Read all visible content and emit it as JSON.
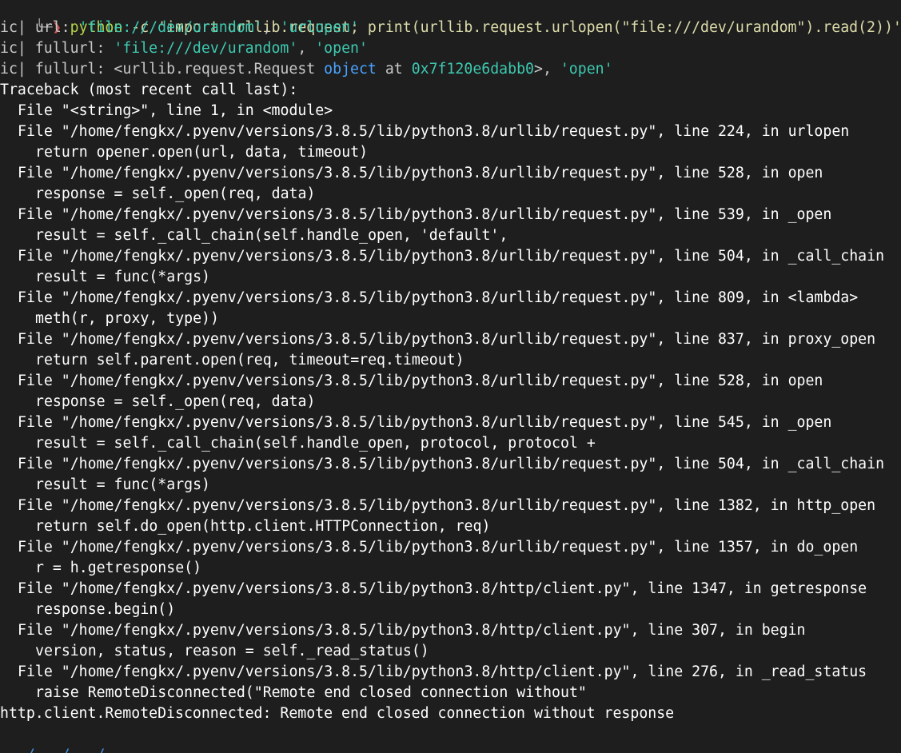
{
  "prompt": {
    "corner_glyph": "╰─",
    "arrow_glyph": "❯",
    "program": "python",
    "args": " -c 'import urllib.request; print(urllib.request.urlopen(\"file:///dev/urandom\").read(2))'"
  },
  "ic_lines": [
    {
      "prefix": "ic|",
      "key": "url",
      "value1": "'file:///dev/urandom'",
      "value2": "'urlopen'"
    },
    {
      "prefix": "ic|",
      "key": "fullurl",
      "value1": "'file:///dev/urandom'",
      "value2": "'open'"
    },
    {
      "prefix": "ic|",
      "key": "fullurl",
      "obj_pre": "<urllib.request.Request ",
      "obj_kw": "object",
      "obj_mid": " at ",
      "obj_addr": "0x7f120e6dabb0",
      "obj_post": ">",
      "value2": "'open'"
    }
  ],
  "traceback": {
    "header": "Traceback (most recent call last):",
    "frames": [
      {
        "file": "File \"<string>\", line 1, in <module>",
        "code": ""
      },
      {
        "file": "File \"/home/fengkx/.pyenv/versions/3.8.5/lib/python3.8/urllib/request.py\", line 224, in urlopen",
        "code": "return opener.open(url, data, timeout)"
      },
      {
        "file": "File \"/home/fengkx/.pyenv/versions/3.8.5/lib/python3.8/urllib/request.py\", line 528, in open",
        "code": "response = self._open(req, data)"
      },
      {
        "file": "File \"/home/fengkx/.pyenv/versions/3.8.5/lib/python3.8/urllib/request.py\", line 539, in _open",
        "code": "result = self._call_chain(self.handle_open, 'default',"
      },
      {
        "file": "File \"/home/fengkx/.pyenv/versions/3.8.5/lib/python3.8/urllib/request.py\", line 504, in _call_chain",
        "code": "result = func(*args)"
      },
      {
        "file": "File \"/home/fengkx/.pyenv/versions/3.8.5/lib/python3.8/urllib/request.py\", line 809, in <lambda>",
        "code": "meth(r, proxy, type))"
      },
      {
        "file": "File \"/home/fengkx/.pyenv/versions/3.8.5/lib/python3.8/urllib/request.py\", line 837, in proxy_open",
        "code": "return self.parent.open(req, timeout=req.timeout)"
      },
      {
        "file": "File \"/home/fengkx/.pyenv/versions/3.8.5/lib/python3.8/urllib/request.py\", line 528, in open",
        "code": "response = self._open(req, data)"
      },
      {
        "file": "File \"/home/fengkx/.pyenv/versions/3.8.5/lib/python3.8/urllib/request.py\", line 545, in _open",
        "code": "result = self._call_chain(self.handle_open, protocol, protocol +"
      },
      {
        "file": "File \"/home/fengkx/.pyenv/versions/3.8.5/lib/python3.8/urllib/request.py\", line 504, in _call_chain",
        "code": "result = func(*args)"
      },
      {
        "file": "File \"/home/fengkx/.pyenv/versions/3.8.5/lib/python3.8/urllib/request.py\", line 1382, in http_open",
        "code": "return self.do_open(http.client.HTTPConnection, req)"
      },
      {
        "file": "File \"/home/fengkx/.pyenv/versions/3.8.5/lib/python3.8/urllib/request.py\", line 1357, in do_open",
        "code": "r = h.getresponse()"
      },
      {
        "file": "File \"/home/fengkx/.pyenv/versions/3.8.5/lib/python3.8/http/client.py\", line 1347, in getresponse",
        "code": "response.begin()"
      },
      {
        "file": "File \"/home/fengkx/.pyenv/versions/3.8.5/lib/python3.8/http/client.py\", line 307, in begin",
        "code": "version, status, reason = self._read_status()"
      },
      {
        "file": "File \"/home/fengkx/.pyenv/versions/3.8.5/lib/python3.8/http/client.py\", line 276, in _read_status",
        "code": "raise RemoteDisconnected(\"Remote end closed connection without\""
      }
    ],
    "exception": "http.client.RemoteDisconnected: Remote end closed connection without response"
  },
  "next_prompt_partial": "  ~/.../.../..."
}
